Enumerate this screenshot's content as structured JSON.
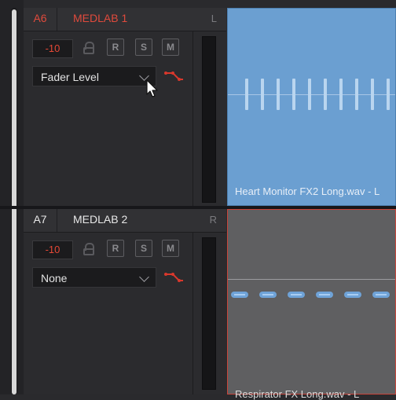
{
  "tracks": [
    {
      "number": "A6",
      "name": "MEDLAB 1",
      "channel": "L",
      "volume": "-10",
      "buttons": {
        "record": "R",
        "solo": "S",
        "mute": "M"
      },
      "automation_mode": "Fader Level",
      "clip_name": "Heart Monitor FX2 Long.wav - L"
    },
    {
      "number": "A7",
      "name": "MEDLAB 2",
      "channel": "R",
      "volume": "-10",
      "buttons": {
        "record": "R",
        "solo": "S",
        "mute": "M"
      },
      "automation_mode": "None",
      "clip_name": "Respirator FX Long.wav - L"
    }
  ],
  "colors": {
    "track_active_name": "#e04a3c",
    "volume_text": "#e54836",
    "clip_heart_monitor": "#6b9fd1",
    "clip_respirator": "#5f5f61",
    "automation_icon": "#d9382c"
  },
  "icons": [
    "lock-icon",
    "automation-curve-icon",
    "chevron-down-icon",
    "mouse-cursor-icon"
  ]
}
